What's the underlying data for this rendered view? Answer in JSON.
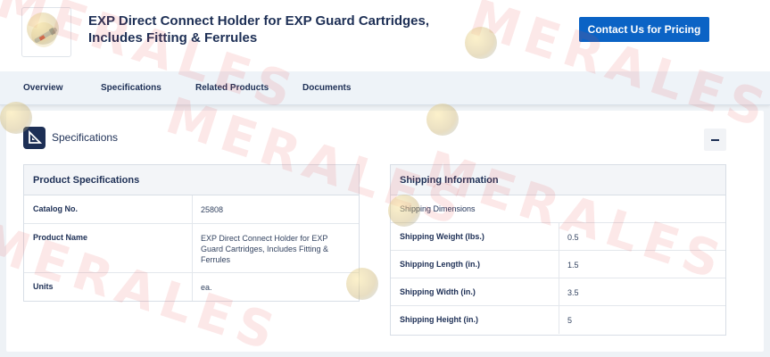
{
  "product": {
    "title": "EXP Direct Connect Holder for EXP Guard Cartridges, Includes Fitting & Ferrules",
    "contact_label": "Contact Us for Pricing"
  },
  "nav": {
    "items": [
      "Overview",
      "Specifications",
      "Related Products",
      "Documents"
    ]
  },
  "section": {
    "title": "Specifications",
    "icon": "ruler-triangle-icon",
    "collapse_icon": "minus-icon"
  },
  "product_specs": {
    "header": "Product Specifications",
    "rows": [
      {
        "label": "Catalog No.",
        "value": "25808"
      },
      {
        "label": "Product Name",
        "value": "EXP Direct Connect Holder for EXP Guard Cartridges, Includes Fitting & Ferrules"
      },
      {
        "label": "Units",
        "value": "ea."
      }
    ]
  },
  "shipping": {
    "header": "Shipping Information",
    "subheader": "Shipping Dimensions",
    "rows": [
      {
        "label": "Shipping Weight (lbs.)",
        "value": "0.5"
      },
      {
        "label": "Shipping Length (in.)",
        "value": "1.5"
      },
      {
        "label": "Shipping Width (in.)",
        "value": "3.5"
      },
      {
        "label": "Shipping Height (in.)",
        "value": "5"
      }
    ]
  },
  "watermark": "MERALES",
  "colors": {
    "primary_button": "#0b63c5",
    "navy": "#1d2f55",
    "watermark": "#e85050"
  }
}
